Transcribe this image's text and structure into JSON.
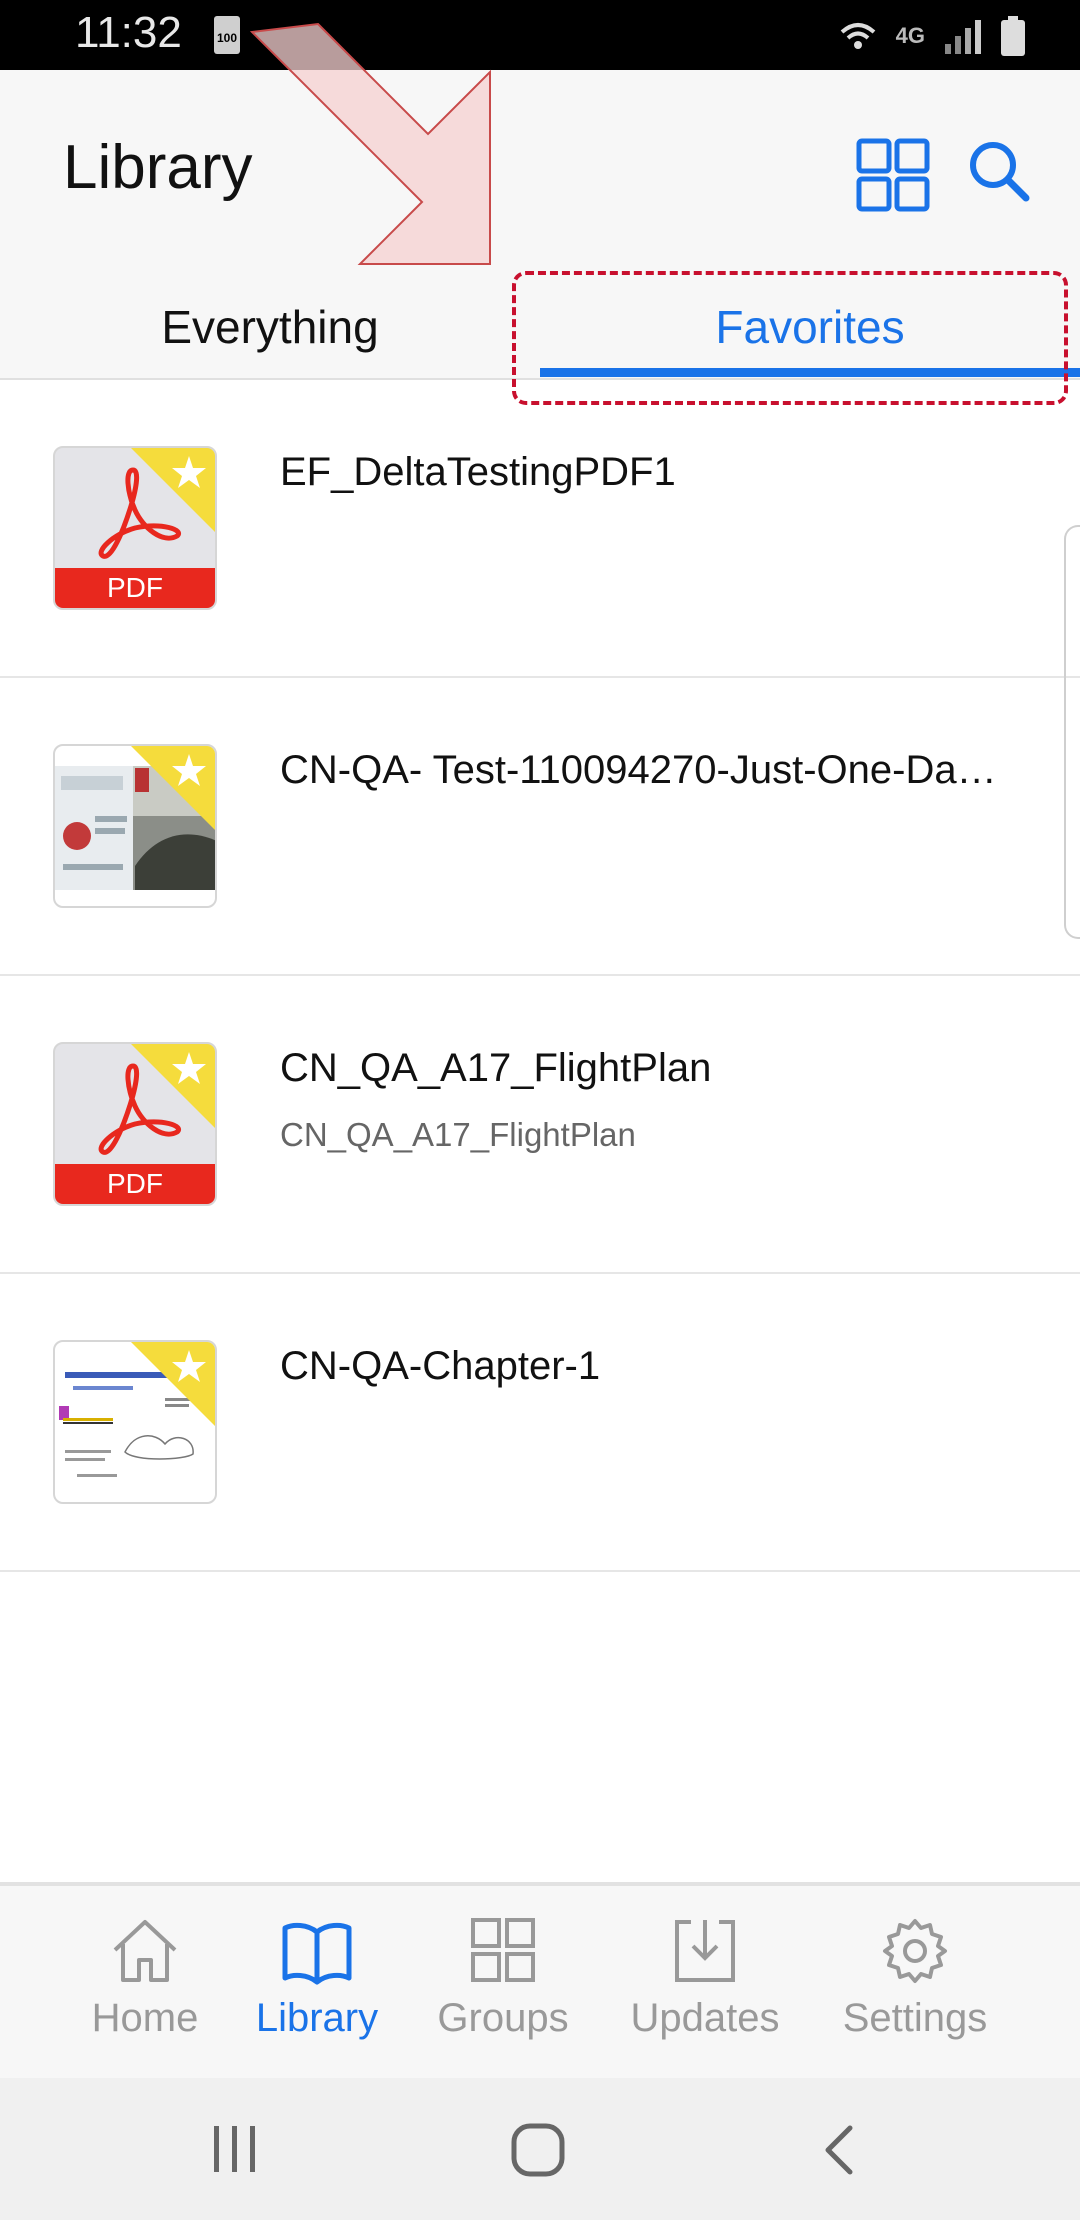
{
  "status_bar": {
    "time": "11:32",
    "battery_badge": "100",
    "network": "4G"
  },
  "header": {
    "title": "Library"
  },
  "tabs": [
    {
      "label": "Everything",
      "selected": false
    },
    {
      "label": "Favorites",
      "selected": true
    }
  ],
  "items": [
    {
      "title": "EF_DeltaTestingPDF1",
      "subtitle": "",
      "thumb": "pdf",
      "favorite": true
    },
    {
      "title": "CN-QA- Test-110094270-Just-One-Da…",
      "subtitle": "",
      "thumb": "photo",
      "favorite": true
    },
    {
      "title": "CN_QA_A17_FlightPlan",
      "subtitle": "CN_QA_A17_FlightPlan",
      "thumb": "pdf",
      "favorite": true
    },
    {
      "title": "CN-QA-Chapter-1",
      "subtitle": "",
      "thumb": "document",
      "favorite": true
    }
  ],
  "pdf_label": "PDF",
  "nav": [
    {
      "label": "Home",
      "icon": "home-icon",
      "active": false
    },
    {
      "label": "Library",
      "icon": "book-icon",
      "active": true
    },
    {
      "label": "Groups",
      "icon": "groups-icon",
      "active": false
    },
    {
      "label": "Updates",
      "icon": "download-icon",
      "active": false
    },
    {
      "label": "Settings",
      "icon": "gear-icon",
      "active": false
    }
  ],
  "colors": {
    "accent": "#1a73e8",
    "pdf_red": "#e8281e",
    "favorite_yellow": "#f5dc3c",
    "annotation_red": "#c8102e"
  }
}
